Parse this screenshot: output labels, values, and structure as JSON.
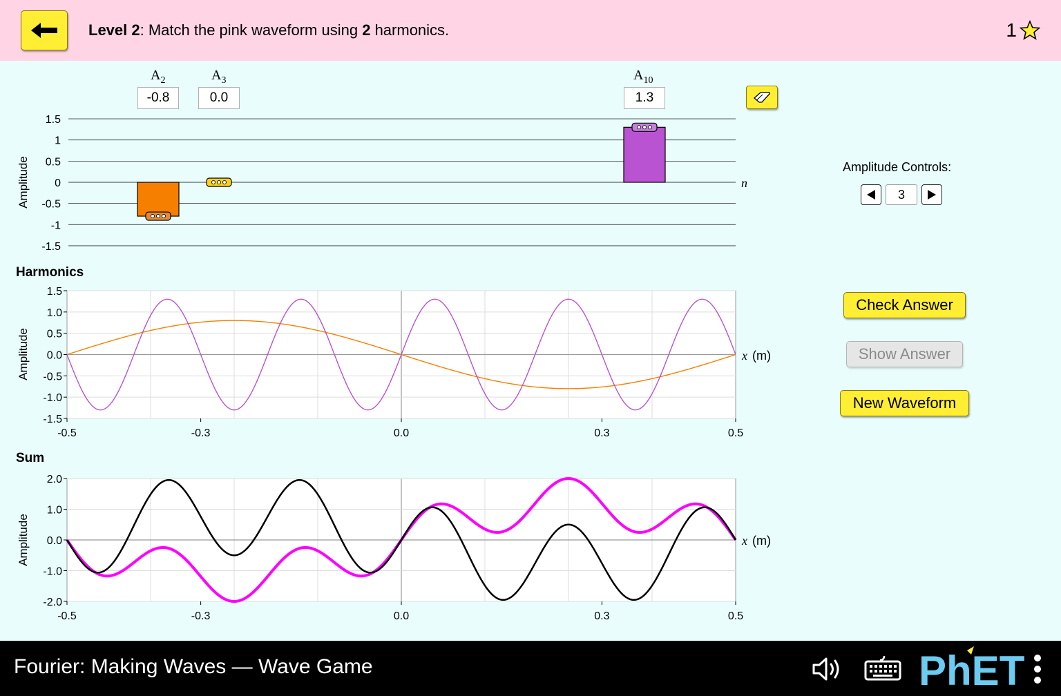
{
  "header": {
    "level_bold": "Level 2",
    "level_text_a": ": Match the pink waveform using ",
    "level_count": "2",
    "level_text_b": " harmonics.",
    "score": "1"
  },
  "amplitudes": {
    "labels": [
      {
        "base": "A",
        "sub": "2",
        "value": "-0.8"
      },
      {
        "base": "A",
        "sub": "3",
        "value": "0.0"
      },
      {
        "base": "A",
        "sub": "10",
        "value": "1.3"
      }
    ],
    "ylabel": "Amplitude",
    "axis_var": "n",
    "yticks": [
      "1.5",
      "1",
      "0.5",
      "0",
      "-0.5",
      "-1",
      "-1.5"
    ]
  },
  "harmonics_section": {
    "title": "Harmonics",
    "ylabel": "Amplitude",
    "yticks": [
      "1.5",
      "1.0",
      "0.5",
      "0.0",
      "-0.5",
      "-1.0",
      "-1.5"
    ],
    "xticks": [
      "-0.5",
      "-0.3",
      "0.0",
      "0.3",
      "0.5"
    ],
    "axis_var": "x",
    "axis_unit": "(m)"
  },
  "sum_section": {
    "title": "Sum",
    "ylabel": "Amplitude",
    "yticks": [
      "2.0",
      "1.0",
      "0.0",
      "-1.0",
      "-2.0"
    ],
    "xticks": [
      "-0.5",
      "-0.3",
      "0.0",
      "0.3",
      "0.5"
    ],
    "axis_var": "x",
    "axis_unit": "(m)"
  },
  "controls": {
    "label": "Amplitude Controls:",
    "value": "3",
    "check": "Check Answer",
    "show": "Show Answer",
    "new": "New Waveform"
  },
  "footer": {
    "title": "Fourier: Making Waves — Wave Game",
    "brand": "PhET"
  },
  "colors": {
    "orange": "#f77f00",
    "purple": "#b953d1",
    "pink": "#ff00ff",
    "black": "#000000"
  },
  "chart_data": [
    {
      "type": "bar",
      "categories": [
        "2",
        "3",
        "10"
      ],
      "values": [
        -0.8,
        0.0,
        1.3
      ],
      "xlabel": "n",
      "ylabel": "Amplitude",
      "ylim": [
        -1.5,
        1.5
      ]
    },
    {
      "type": "line",
      "title": "Harmonics",
      "xlabel": "x (m)",
      "ylabel": "Amplitude",
      "xlim": [
        -0.5,
        0.5
      ],
      "ylim": [
        -1.5,
        1.5
      ],
      "series": [
        {
          "harmonic": 2,
          "amplitude": -0.8
        },
        {
          "harmonic": 10,
          "amplitude": 1.3
        }
      ]
    },
    {
      "type": "line",
      "title": "Sum",
      "xlabel": "x (m)",
      "ylabel": "Amplitude",
      "xlim": [
        -0.5,
        0.5
      ],
      "ylim": [
        -2.0,
        2.0
      ],
      "series": [
        {
          "color": "pink",
          "harmonics": [
            {
              "n": 2,
              "a": 1.25
            },
            {
              "n": 10,
              "a": 0.75
            }
          ]
        },
        {
          "color": "black",
          "harmonics": [
            {
              "n": 2,
              "a": -0.8
            },
            {
              "n": 10,
              "a": 1.3
            }
          ]
        }
      ]
    }
  ]
}
